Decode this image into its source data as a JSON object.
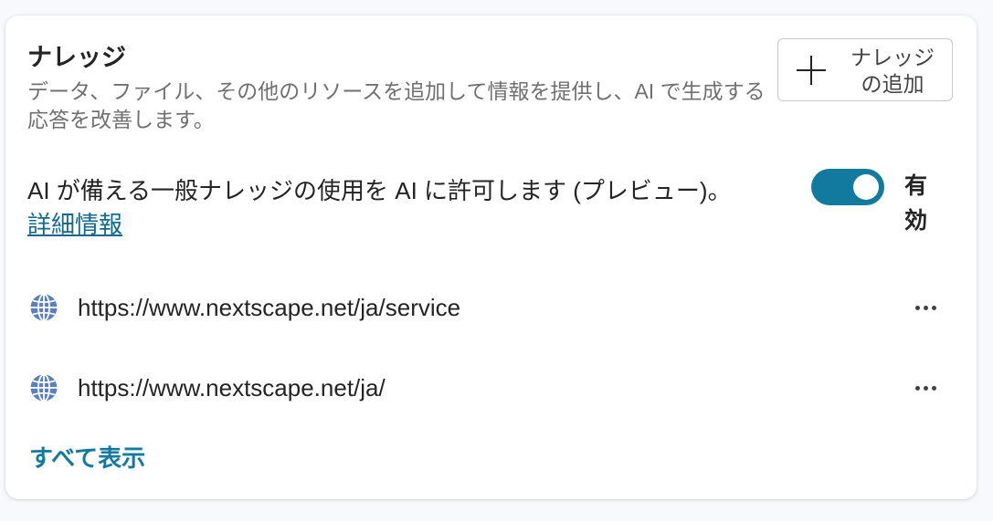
{
  "knowledge": {
    "title": "ナレッジ",
    "description": "データ、ファイル、その他のリソースを追加して情報を提供し、AI で生成する応答を改善します。",
    "add_button_label": "ナレッジの追加",
    "ai_general_knowledge_text": "AI が備える一般ナレッジの使用を AI に許可します (プレビュー)。",
    "learn_more_link": "詳細情報",
    "toggle_state": "on",
    "toggle_status_label": "有効",
    "sources": [
      {
        "url": "https://www.nextscape.net/ja/service",
        "icon": "globe-icon"
      },
      {
        "url": "https://www.nextscape.net/ja/",
        "icon": "globe-icon"
      }
    ],
    "show_all_label": "すべて表示"
  },
  "colors": {
    "accent": "#137a9f",
    "link": "#11698f",
    "text_primary": "#242424",
    "text_secondary": "#707070",
    "globe": "#5a7fbf"
  }
}
